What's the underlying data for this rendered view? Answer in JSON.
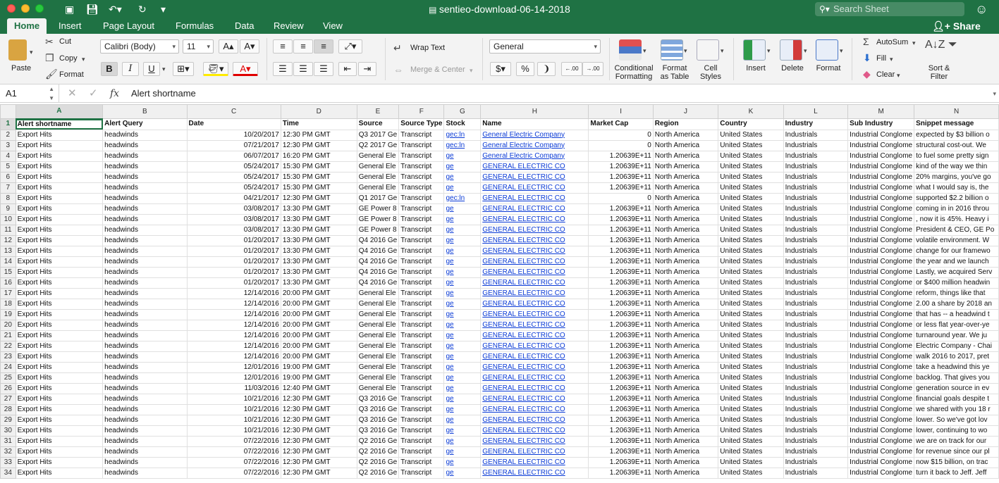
{
  "window": {
    "title": "sentieo-download-06-14-2018",
    "search_placeholder": "Search Sheet"
  },
  "tabs": [
    "Home",
    "Insert",
    "Page Layout",
    "Formulas",
    "Data",
    "Review",
    "View"
  ],
  "share_label": "Share",
  "ribbon": {
    "paste": "Paste",
    "cut": "Cut",
    "copy": "Copy",
    "format_painter": "Format",
    "font_name": "Calibri (Body)",
    "font_size": "11",
    "bold": "B",
    "italic": "I",
    "underline": "U",
    "wrap_text": "Wrap Text",
    "merge_center": "Merge & Center",
    "number_format": "General",
    "currency": "$",
    "percent": "%",
    "comma": "❩",
    "inc_decimal": ".00",
    "dec_decimal": ".00",
    "cond_fmt_1": "Conditional",
    "cond_fmt_2": "Formatting",
    "fmt_table_1": "Format",
    "fmt_table_2": "as Table",
    "cell_styles_1": "Cell",
    "cell_styles_2": "Styles",
    "insert": "Insert",
    "delete": "Delete",
    "format": "Format",
    "autosum": "AutoSum",
    "fill": "Fill",
    "clear": "Clear",
    "sort_filter_1": "Sort &",
    "sort_filter_2": "Filter"
  },
  "formula_bar": {
    "name_box": "A1",
    "fx": "fx",
    "content": "Alert shortname"
  },
  "sheet": {
    "columns": [
      "A",
      "B",
      "C",
      "D",
      "E",
      "F",
      "G",
      "H",
      "I",
      "J",
      "K",
      "L",
      "M",
      "N"
    ],
    "header_row": [
      "Alert shortname",
      "Alert Query",
      "Date",
      "Time",
      "Source",
      "Source Type",
      "Stock",
      "Name",
      "Market Cap",
      "Region",
      "Country",
      "Industry",
      "Sub Industry",
      "Snippet message"
    ],
    "rows": [
      [
        "Export Hits",
        "headwinds",
        "10/20/2017",
        "12:30 PM GMT",
        "Q3 2017 Ge",
        "Transcript",
        "gec:ln",
        "General Electric Company",
        "0",
        "North America",
        "United States",
        "Industrials",
        "Industrial Conglome",
        "expected by $3 billion o"
      ],
      [
        "Export Hits",
        "headwinds",
        "07/21/2017",
        "12:30 PM GMT",
        "Q2 2017 Ge",
        "Transcript",
        "gec:ln",
        "General Electric Company",
        "0",
        "North America",
        "United States",
        "Industrials",
        "Industrial Conglome",
        "structural cost-out. We"
      ],
      [
        "Export Hits",
        "headwinds",
        "06/07/2017",
        "16:20 PM GMT",
        "General Ele",
        "Transcript",
        "ge",
        "General Electric Company",
        "1.20639E+11",
        "North America",
        "United States",
        "Industrials",
        "Industrial Conglome",
        "to fuel some pretty sign"
      ],
      [
        "Export Hits",
        "headwinds",
        "05/24/2017",
        "15:30 PM GMT",
        "General Ele",
        "Transcript",
        "ge",
        "GENERAL ELECTRIC CO",
        "1.20639E+11",
        "North America",
        "United States",
        "Industrials",
        "Industrial Conglome",
        "kind of the way we thin"
      ],
      [
        "Export Hits",
        "headwinds",
        "05/24/2017",
        "15:30 PM GMT",
        "General Ele",
        "Transcript",
        "ge",
        "GENERAL ELECTRIC CO",
        "1.20639E+11",
        "North America",
        "United States",
        "Industrials",
        "Industrial Conglome",
        "20% margins, you've go"
      ],
      [
        "Export Hits",
        "headwinds",
        "05/24/2017",
        "15:30 PM GMT",
        "General Ele",
        "Transcript",
        "ge",
        "GENERAL ELECTRIC CO",
        "1.20639E+11",
        "North America",
        "United States",
        "Industrials",
        "Industrial Conglome",
        "what I would say is, the"
      ],
      [
        "Export Hits",
        "headwinds",
        "04/21/2017",
        "12:30 PM GMT",
        "Q1 2017 Ge",
        "Transcript",
        "gec:ln",
        "GENERAL ELECTRIC CO",
        "0",
        "North America",
        "United States",
        "Industrials",
        "Industrial Conglome",
        "supported $2.2 billion o"
      ],
      [
        "Export Hits",
        "headwinds",
        "03/08/2017",
        "13:30 PM GMT",
        "GE Power 8",
        "Transcript",
        "ge",
        "GENERAL ELECTRIC CO",
        "1.20639E+11",
        "North America",
        "United States",
        "Industrials",
        "Industrial Conglome",
        "coming in in 2016 throu"
      ],
      [
        "Export Hits",
        "headwinds",
        "03/08/2017",
        "13:30 PM GMT",
        "GE Power 8",
        "Transcript",
        "ge",
        "GENERAL ELECTRIC CO",
        "1.20639E+11",
        "North America",
        "United States",
        "Industrials",
        "Industrial Conglome",
        ", now it is 45%. Heavy i"
      ],
      [
        "Export Hits",
        "headwinds",
        "03/08/2017",
        "13:30 PM GMT",
        "GE Power 8",
        "Transcript",
        "ge",
        "GENERAL ELECTRIC CO",
        "1.20639E+11",
        "North America",
        "United States",
        "Industrials",
        "Industrial Conglome",
        "President & CEO, GE Po"
      ],
      [
        "Export Hits",
        "headwinds",
        "01/20/2017",
        "13:30 PM GMT",
        "Q4 2016 Ge",
        "Transcript",
        "ge",
        "GENERAL ELECTRIC CO",
        "1.20639E+11",
        "North America",
        "United States",
        "Industrials",
        "Industrial Conglome",
        "volatile environment. W"
      ],
      [
        "Export Hits",
        "headwinds",
        "01/20/2017",
        "13:30 PM GMT",
        "Q4 2016 Ge",
        "Transcript",
        "ge",
        "GENERAL ELECTRIC CO",
        "1.20639E+11",
        "North America",
        "United States",
        "Industrials",
        "Industrial Conglome",
        "change for our framewo"
      ],
      [
        "Export Hits",
        "headwinds",
        "01/20/2017",
        "13:30 PM GMT",
        "Q4 2016 Ge",
        "Transcript",
        "ge",
        "GENERAL ELECTRIC CO",
        "1.20639E+11",
        "North America",
        "United States",
        "Industrials",
        "Industrial Conglome",
        "the year and we launch"
      ],
      [
        "Export Hits",
        "headwinds",
        "01/20/2017",
        "13:30 PM GMT",
        "Q4 2016 Ge",
        "Transcript",
        "ge",
        "GENERAL ELECTRIC CO",
        "1.20639E+11",
        "North America",
        "United States",
        "Industrials",
        "Industrial Conglome",
        "Lastly, we acquired Serv"
      ],
      [
        "Export Hits",
        "headwinds",
        "01/20/2017",
        "13:30 PM GMT",
        "Q4 2016 Ge",
        "Transcript",
        "ge",
        "GENERAL ELECTRIC CO",
        "1.20639E+11",
        "North America",
        "United States",
        "Industrials",
        "Industrial Conglome",
        "or $400 million headwin"
      ],
      [
        "Export Hits",
        "headwinds",
        "12/14/2016",
        "20:00 PM GMT",
        "General Ele",
        "Transcript",
        "ge",
        "GENERAL ELECTRIC CO",
        "1.20639E+11",
        "North America",
        "United States",
        "Industrials",
        "Industrial Conglome",
        "reform, things like that"
      ],
      [
        "Export Hits",
        "headwinds",
        "12/14/2016",
        "20:00 PM GMT",
        "General Ele",
        "Transcript",
        "ge",
        "GENERAL ELECTRIC CO",
        "1.20639E+11",
        "North America",
        "United States",
        "Industrials",
        "Industrial Conglome",
        "2.00 a share by 2018 an"
      ],
      [
        "Export Hits",
        "headwinds",
        "12/14/2016",
        "20:00 PM GMT",
        "General Ele",
        "Transcript",
        "ge",
        "GENERAL ELECTRIC CO",
        "1.20639E+11",
        "North America",
        "United States",
        "Industrials",
        "Industrial Conglome",
        "that has -- a headwind t"
      ],
      [
        "Export Hits",
        "headwinds",
        "12/14/2016",
        "20:00 PM GMT",
        "General Ele",
        "Transcript",
        "ge",
        "GENERAL ELECTRIC CO",
        "1.20639E+11",
        "North America",
        "United States",
        "Industrials",
        "Industrial Conglome",
        "or less flat year-over-ye"
      ],
      [
        "Export Hits",
        "headwinds",
        "12/14/2016",
        "20:00 PM GMT",
        "General Ele",
        "Transcript",
        "ge",
        "GENERAL ELECTRIC CO",
        "1.20639E+11",
        "North America",
        "United States",
        "Industrials",
        "Industrial Conglome",
        "turnaround year. We ju"
      ],
      [
        "Export Hits",
        "headwinds",
        "12/14/2016",
        "20:00 PM GMT",
        "General Ele",
        "Transcript",
        "ge",
        "GENERAL ELECTRIC CO",
        "1.20639E+11",
        "North America",
        "United States",
        "Industrials",
        "Industrial Conglome",
        "Electric Company - Chai"
      ],
      [
        "Export Hits",
        "headwinds",
        "12/14/2016",
        "20:00 PM GMT",
        "General Ele",
        "Transcript",
        "ge",
        "GENERAL ELECTRIC CO",
        "1.20639E+11",
        "North America",
        "United States",
        "Industrials",
        "Industrial Conglome",
        "walk 2016 to 2017, pret"
      ],
      [
        "Export Hits",
        "headwinds",
        "12/01/2016",
        "19:00 PM GMT",
        "General Ele",
        "Transcript",
        "ge",
        "GENERAL ELECTRIC CO",
        "1.20639E+11",
        "North America",
        "United States",
        "Industrials",
        "Industrial Conglome",
        "take a headwind this ye"
      ],
      [
        "Export Hits",
        "headwinds",
        "12/01/2016",
        "19:00 PM GMT",
        "General Ele",
        "Transcript",
        "ge",
        "GENERAL ELECTRIC CO",
        "1.20639E+11",
        "North America",
        "United States",
        "Industrials",
        "Industrial Conglome",
        "backlog. That gives you"
      ],
      [
        "Export Hits",
        "headwinds",
        "11/03/2016",
        "12:40 PM GMT",
        "General Ele",
        "Transcript",
        "ge",
        "GENERAL ELECTRIC CO",
        "1.20639E+11",
        "North America",
        "United States",
        "Industrials",
        "Industrial Conglome",
        "generation source in ev"
      ],
      [
        "Export Hits",
        "headwinds",
        "10/21/2016",
        "12:30 PM GMT",
        "Q3 2016 Ge",
        "Transcript",
        "ge",
        "GENERAL ELECTRIC CO",
        "1.20639E+11",
        "North America",
        "United States",
        "Industrials",
        "Industrial Conglome",
        "financial goals despite t"
      ],
      [
        "Export Hits",
        "headwinds",
        "10/21/2016",
        "12:30 PM GMT",
        "Q3 2016 Ge",
        "Transcript",
        "ge",
        "GENERAL ELECTRIC CO",
        "1.20639E+11",
        "North America",
        "United States",
        "Industrials",
        "Industrial Conglome",
        "we shared with you 18 r"
      ],
      [
        "Export Hits",
        "headwinds",
        "10/21/2016",
        "12:30 PM GMT",
        "Q3 2016 Ge",
        "Transcript",
        "ge",
        "GENERAL ELECTRIC CO",
        "1.20639E+11",
        "North America",
        "United States",
        "Industrials",
        "Industrial Conglome",
        "lower.  So we've got lov"
      ],
      [
        "Export Hits",
        "headwinds",
        "10/21/2016",
        "12:30 PM GMT",
        "Q3 2016 Ge",
        "Transcript",
        "ge",
        "GENERAL ELECTRIC CO",
        "1.20639E+11",
        "North America",
        "United States",
        "Industrials",
        "Industrial Conglome",
        "lower, continuing to wo"
      ],
      [
        "Export Hits",
        "headwinds",
        "07/22/2016",
        "12:30 PM GMT",
        "Q2 2016 Ge",
        "Transcript",
        "ge",
        "GENERAL ELECTRIC CO",
        "1.20639E+11",
        "North America",
        "United States",
        "Industrials",
        "Industrial Conglome",
        "we are on track for our"
      ],
      [
        "Export Hits",
        "headwinds",
        "07/22/2016",
        "12:30 PM GMT",
        "Q2 2016 Ge",
        "Transcript",
        "ge",
        "GENERAL ELECTRIC CO",
        "1.20639E+11",
        "North America",
        "United States",
        "Industrials",
        "Industrial Conglome",
        "for revenue since our pl"
      ],
      [
        "Export Hits",
        "headwinds",
        "07/22/2016",
        "12:30 PM GMT",
        "Q2 2016 Ge",
        "Transcript",
        "ge",
        "GENERAL ELECTRIC CO",
        "1.20639E+11",
        "North America",
        "United States",
        "Industrials",
        "Industrial Conglome",
        "now $15 billion, on trac"
      ],
      [
        "Export Hits",
        "headwinds",
        "07/22/2016",
        "12:30 PM GMT",
        "Q2 2016 Ge",
        "Transcript",
        "ge",
        "GENERAL ELECTRIC CO",
        "1.20639E+11",
        "North America",
        "United States",
        "Industrials",
        "Industrial Conglome",
        "turn it back to Jeff.  Jeff"
      ]
    ]
  },
  "colors": {
    "accent": "#1f7244",
    "link": "#0b3bd6"
  }
}
